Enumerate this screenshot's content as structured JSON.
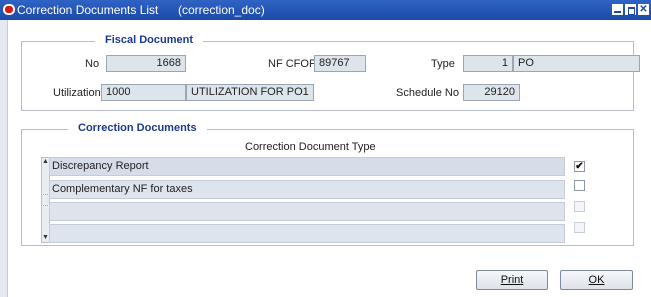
{
  "window": {
    "title": "Correction Documents List",
    "subtitle": "(correction_doc)"
  },
  "fiscal": {
    "group_title": "Fiscal Document",
    "no_label": "No",
    "no_value": "1668",
    "nfcfop_label": "NF CFOP",
    "nfcfop_value": "89767",
    "type_label": "Type",
    "type_num": "1",
    "type_code": "PO",
    "utilization_label": "Utilization",
    "utilization_code": "1000",
    "utilization_desc": "UTILIZATION FOR PO1",
    "schedule_label": "Schedule No",
    "schedule_value": "29120"
  },
  "correction": {
    "group_title": "Correction Documents",
    "column_header": "Correction Document Type",
    "rows": [
      {
        "label": "Discrepancy Report",
        "checked": "✔"
      },
      {
        "label": "Complementary NF for taxes",
        "checked": ""
      },
      {
        "label": "",
        "checked": ""
      },
      {
        "label": "",
        "checked": ""
      }
    ]
  },
  "buttons": {
    "print": "Print",
    "ok": "OK"
  }
}
